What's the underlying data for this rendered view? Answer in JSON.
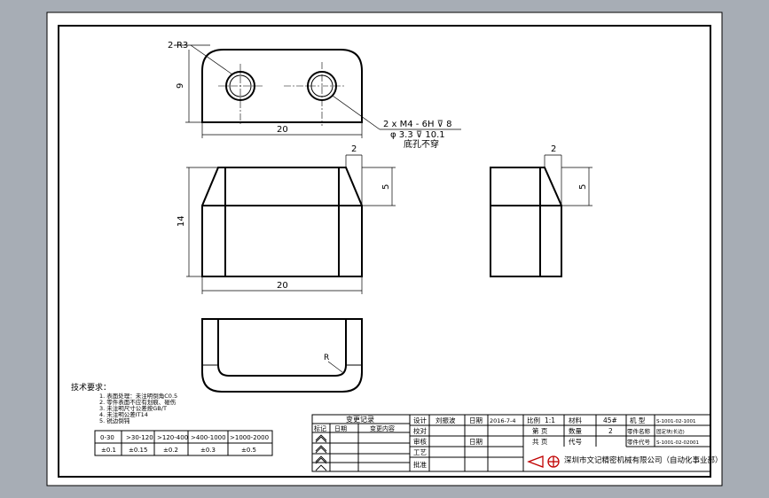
{
  "drawing": {
    "bg": "#a7adb5",
    "paper": "#ffffff",
    "line": "#000000",
    "thin": "#444444"
  },
  "top_view": {
    "radius_note": "2-R3",
    "height_dim": "9",
    "width_dim": "20",
    "hole_note_line1": "2 x M4 - 6H ⊽ 8",
    "hole_note_line2": "φ 3.3 ⊽ 10.1",
    "hole_note_line3": "底孔不穿"
  },
  "front_view": {
    "chamfer_dim": "2",
    "chamfer_height_dim": "5",
    "height_dim": "14",
    "width_dim": "20"
  },
  "side_view": {
    "chamfer_dim": "2",
    "chamfer_height_dim": "5"
  },
  "bottom_view": {
    "radius_label": "R"
  },
  "tech_req": {
    "title": "技术要求：",
    "items": [
      "1. 表面处理：未注明倒角C0.5",
      "2. 零件表面不应有划痕、碰伤",
      "3. 未注明尺寸公差按GB/T",
      "4. 未注明公差IT14",
      "5. 锐边倒钝"
    ]
  },
  "tolerance_table": {
    "headers": [
      "0-30",
      ">30-120",
      ">120-400",
      ">400-1000",
      ">1000-2000"
    ],
    "values": [
      "±0.1",
      "±0.15",
      "±0.2",
      "±0.3",
      "±0.5"
    ]
  },
  "revision_table": {
    "title": "变更记录",
    "headers": [
      "标记",
      "日期",
      "变更内容"
    ],
    "marks": [
      "",
      "",
      ""
    ]
  },
  "title_block": {
    "row_labels": [
      "设计",
      "校对",
      "审核",
      "工艺",
      "批准"
    ],
    "designer": "刘振波",
    "date_label_1": "日期",
    "date_value": "2016-7-4",
    "date_label_2": "日期",
    "scale_label": "比例",
    "scale_value": "1:1",
    "material_label": "材料",
    "material_value": "45#",
    "model_label": "机 型",
    "model_value": "S-1001-02-1001",
    "sheet_label": "第 页",
    "qty_label": "数量",
    "qty_value": "2",
    "part_name_label": "零件名称",
    "part_name_value": "固定块(长边)",
    "total_label": "共 页",
    "code_label": "代号",
    "part_no_label": "零件代号",
    "part_no_value": "S-1001-02-02001",
    "company": "深圳市文记精密机械有限公司（自动化事业部）"
  }
}
